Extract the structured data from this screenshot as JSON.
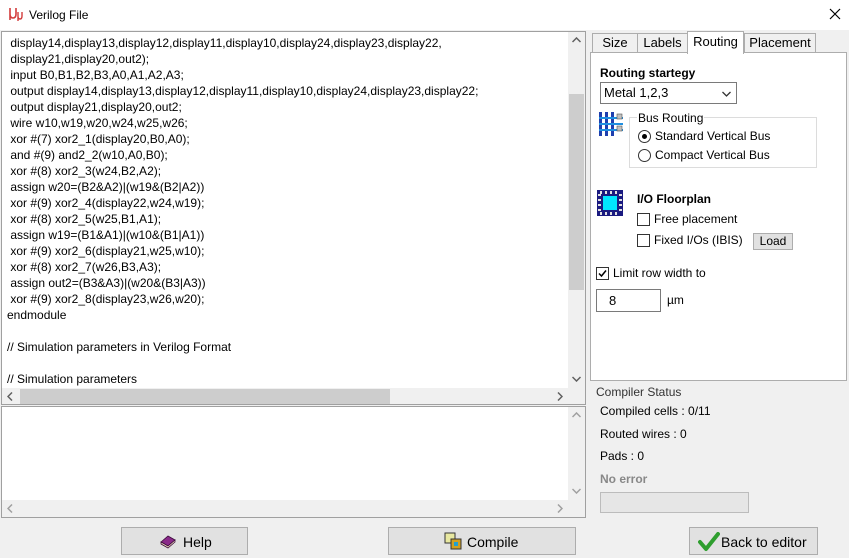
{
  "window": {
    "title": "Verilog File",
    "close_icon": "close-x-icon",
    "app_icon": "mu-logo-icon"
  },
  "editor": {
    "lines": [
      " display14,display13,display12,display11,display10,display24,display23,display22,",
      " display21,display20,out2);",
      " input B0,B1,B2,B3,A0,A1,A2,A3;",
      " output display14,display13,display12,display11,display10,display24,display23,display22;",
      " output display21,display20,out2;",
      " wire w10,w19,w20,w24,w25,w26;",
      " xor #(7) xor2_1(display20,B0,A0);",
      " and #(9) and2_2(w10,A0,B0);",
      " xor #(8) xor2_3(w24,B2,A2);",
      " assign w20=(B2&A2)|(w19&(B2|A2))",
      " xor #(9) xor2_4(display22,w24,w19);",
      " xor #(8) xor2_5(w25,B1,A1);",
      " assign w19=(B1&A1)|(w10&(B1|A1))",
      " xor #(9) xor2_6(display21,w25,w10);",
      " xor #(8) xor2_7(w26,B3,A3);",
      " assign out2=(B3&A3)|(w20&(B3|A3))",
      " xor #(9) xor2_8(display23,w26,w20);",
      "endmodule",
      "",
      "// Simulation parameters in Verilog Format",
      "",
      "// Simulation parameters"
    ]
  },
  "tabs": [
    {
      "label": "Size",
      "active": false
    },
    {
      "label": "Labels",
      "active": false
    },
    {
      "label": "Routing",
      "active": true
    },
    {
      "label": "Placement",
      "active": false
    }
  ],
  "routing": {
    "strategy_label": "Routing startegy",
    "strategy_value": "Metal 1,2,3",
    "bus_routing_title": "Bus Routing",
    "bus_icon": "bus-routing-icon",
    "bus_options": [
      {
        "label": "Standard Vertical Bus",
        "selected": true
      },
      {
        "label": "Compact Vertical Bus",
        "selected": false
      }
    ],
    "io_title": "I/O Floorplan",
    "io_icon": "chip-floorplan-icon",
    "free_placement_label": "Free placement",
    "free_placement_checked": false,
    "fixed_io_label": "Fixed I/Os (IBIS)",
    "fixed_io_checked": false,
    "load_label": "Load",
    "limit_row_label": "Limit row width to",
    "limit_row_checked": true,
    "row_width_value": "8",
    "row_width_unit": "µm"
  },
  "compiler_status": {
    "title": "Compiler Status",
    "compiled_cells": "Compiled cells : 0/11",
    "routed_wires": "Routed wires : 0",
    "pads": "Pads : 0",
    "error": "No error",
    "progress": 0
  },
  "buttons": {
    "help": "Help",
    "compile": "Compile",
    "back": "Back to editor"
  },
  "colors": {
    "accent_blue": "#0078d7",
    "chip_cyan": "#00e5ff",
    "check_green": "#2e9e2e"
  }
}
